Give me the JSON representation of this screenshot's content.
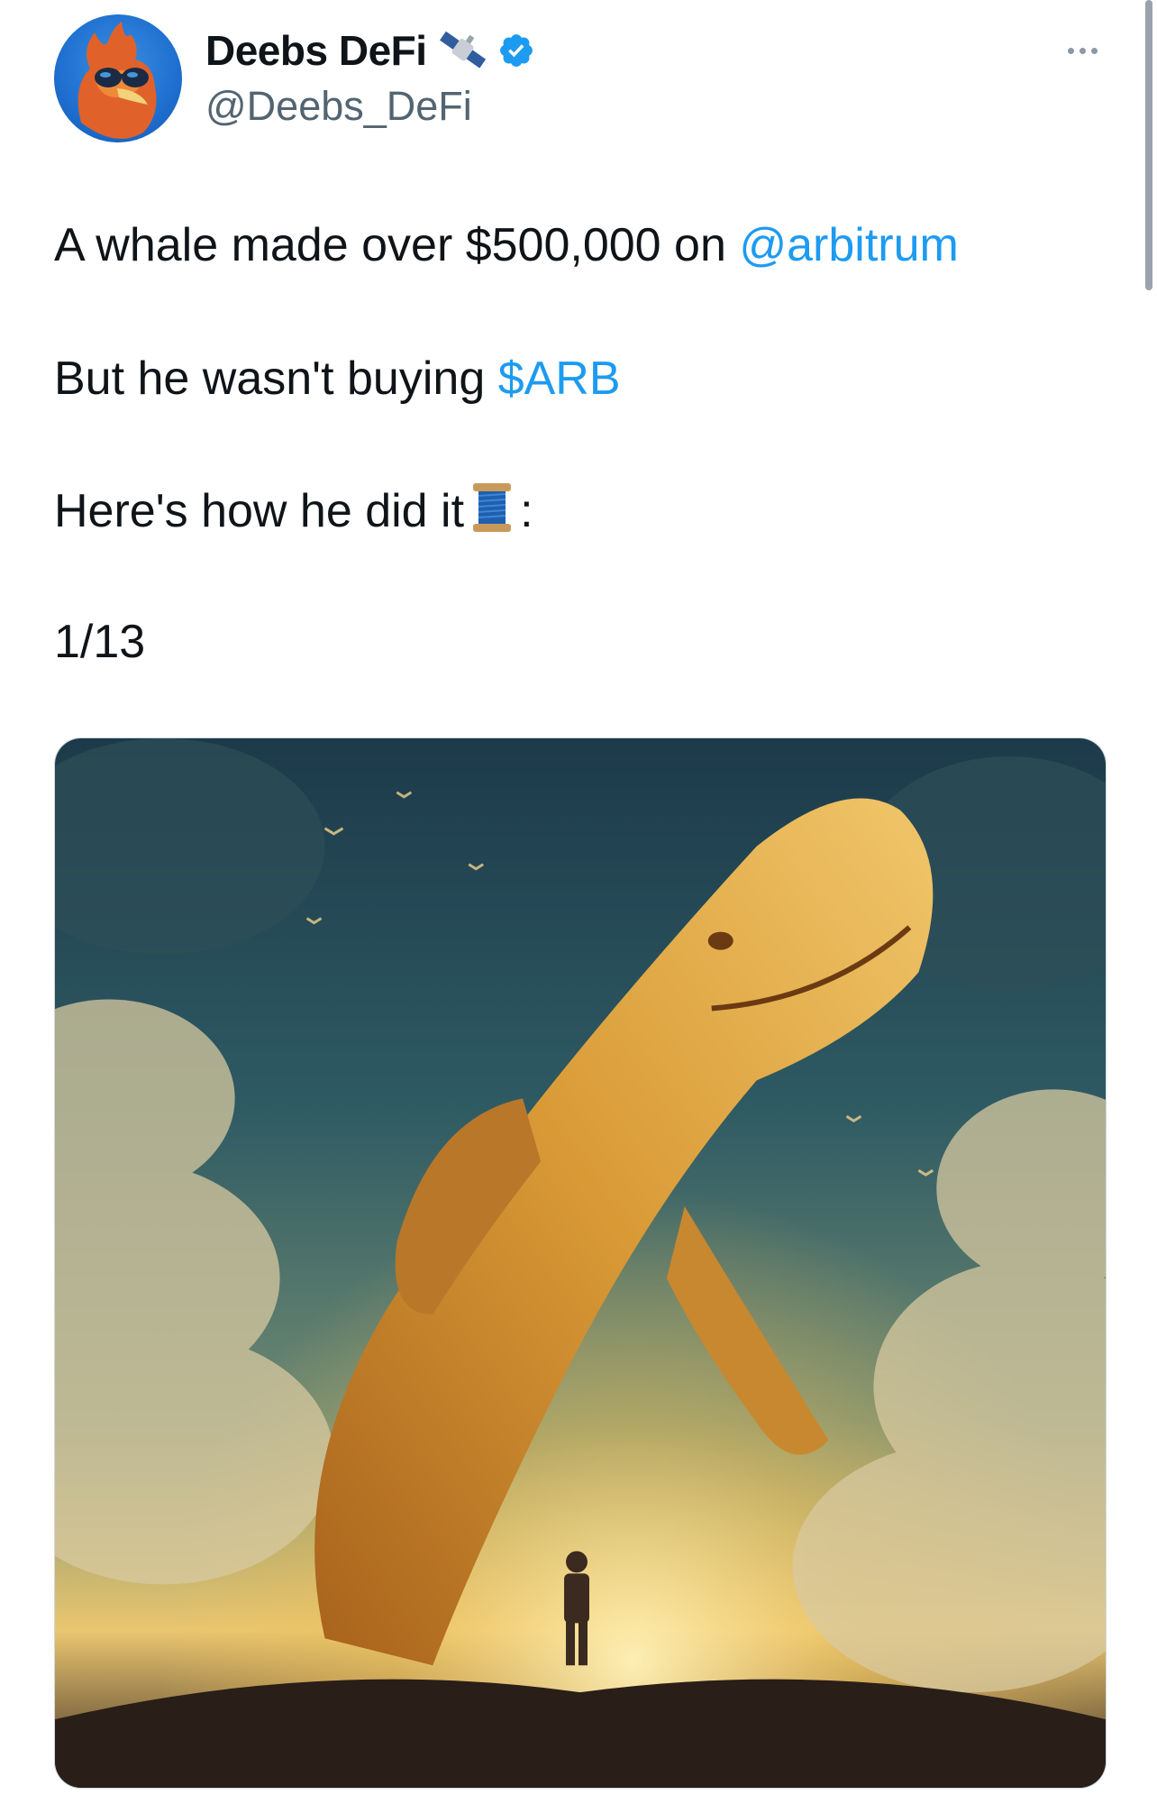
{
  "author": {
    "display_name": "Deebs DeFi",
    "handle": "@Deebs_DeFi",
    "verified": true,
    "name_emoji": "satellite-icon",
    "avatar": "phoenix-with-sunglasses-avatar"
  },
  "tweet": {
    "line1_prefix": "A whale made over $500,000 on ",
    "line1_mention": "@arbitrum",
    "line2_prefix": "But he wasn't buying ",
    "line2_cashtag": "$ARB",
    "line3_prefix": "Here's how he did it",
    "line3_suffix": ":",
    "line3_emoji": "thread-spool-icon",
    "line4": "1/13"
  },
  "media": {
    "type": "image",
    "subject": "golden-whale-in-sky-illustration"
  },
  "colors": {
    "link": "#1d9bf0",
    "text": "#0f1419",
    "secondary": "#536471",
    "verified": "#1d9bf0"
  }
}
